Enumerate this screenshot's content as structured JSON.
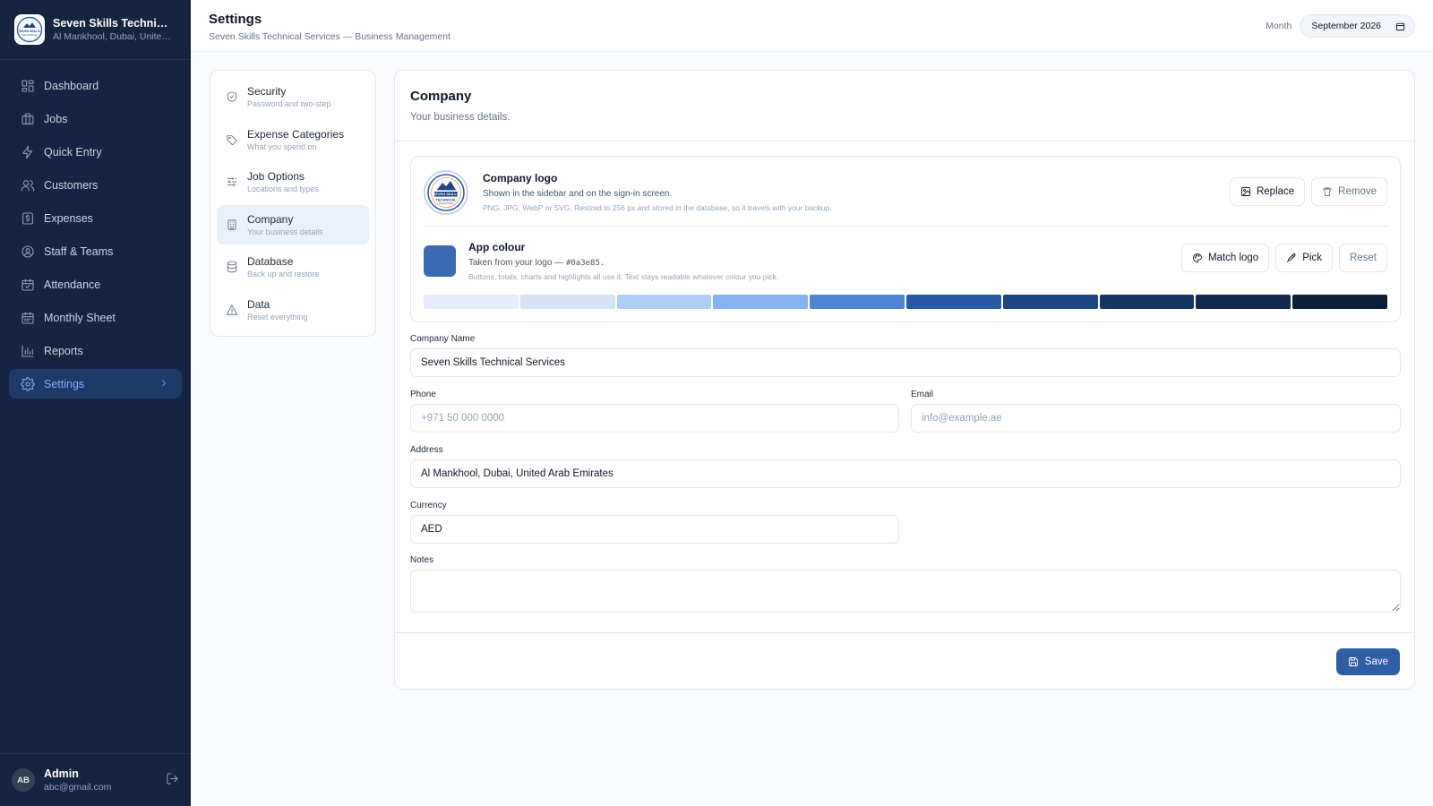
{
  "brand": {
    "name": "Seven Skills Technical ...",
    "location": "Al Mankhool, Dubai, United ...",
    "logo_text_top": "SEVEN SKILLS",
    "logo_text_bottom": "TECHNICAL"
  },
  "sidebar": {
    "items": [
      {
        "label": "Dashboard",
        "icon": "dashboard-icon"
      },
      {
        "label": "Jobs",
        "icon": "briefcase-icon"
      },
      {
        "label": "Quick Entry",
        "icon": "lightning-icon"
      },
      {
        "label": "Customers",
        "icon": "users-icon"
      },
      {
        "label": "Expenses",
        "icon": "receipt-icon"
      },
      {
        "label": "Staff & Teams",
        "icon": "user-circle-icon"
      },
      {
        "label": "Attendance",
        "icon": "calendar-check-icon"
      },
      {
        "label": "Monthly Sheet",
        "icon": "calendar-icon"
      },
      {
        "label": "Reports",
        "icon": "bar-chart-icon"
      },
      {
        "label": "Settings",
        "icon": "gear-icon",
        "active": true
      }
    ]
  },
  "user": {
    "initials": "AB",
    "name": "Admin",
    "email": "abc@gmail.com"
  },
  "header": {
    "title": "Settings",
    "subtitle": "Seven Skills Technical Services — Business Management",
    "month_label": "Month",
    "month_value": "September 2026"
  },
  "settings_nav": {
    "items": [
      {
        "title": "Security",
        "sub": "Password and two-step",
        "icon": "shield-icon"
      },
      {
        "title": "Expense Categories",
        "sub": "What you spend on",
        "icon": "tag-icon"
      },
      {
        "title": "Job Options",
        "sub": "Locations and types",
        "icon": "sliders-icon"
      },
      {
        "title": "Company",
        "sub": "Your business details",
        "icon": "building-icon",
        "active": true
      },
      {
        "title": "Database",
        "sub": "Back up and restore",
        "icon": "database-icon"
      },
      {
        "title": "Data",
        "sub": "Reset everything",
        "icon": "warning-icon"
      }
    ]
  },
  "company": {
    "title": "Company",
    "subtitle": "Your business details.",
    "logo": {
      "title": "Company logo",
      "desc": "Shown in the sidebar and on the sign-in screen.",
      "note": "PNG, JPG, WebP or SVG. Resized to 256 px and stored in the database, so it travels with your backup.",
      "replace_label": "Replace",
      "remove_label": "Remove"
    },
    "colour": {
      "title": "App colour",
      "desc_prefix": "Taken from your logo — ",
      "hex": "#0a3e85.",
      "note": "Buttons, totals, charts and highlights all use it. Text stays readable whatever colour you pick.",
      "match_label": "Match logo",
      "pick_label": "Pick",
      "reset_label": "Reset",
      "swatch": "#3a6ab4",
      "shades": [
        "#e8eef9",
        "#d2e2f7",
        "#b0cef5",
        "#86b3ef",
        "#4e84d3",
        "#2a5aa4",
        "#1d4684",
        "#163766",
        "#102a50",
        "#0c1e3a"
      ]
    },
    "fields": {
      "name_label": "Company Name",
      "name_value": "Seven Skills Technical Services",
      "phone_label": "Phone",
      "phone_placeholder": "+971 50 000 0000",
      "email_label": "Email",
      "email_placeholder": "info@example.ae",
      "address_label": "Address",
      "address_value": "Al Mankhool, Dubai, United Arab Emirates",
      "currency_label": "Currency",
      "currency_value": "AED",
      "notes_label": "Notes",
      "notes_value": ""
    },
    "save_label": "Save"
  }
}
